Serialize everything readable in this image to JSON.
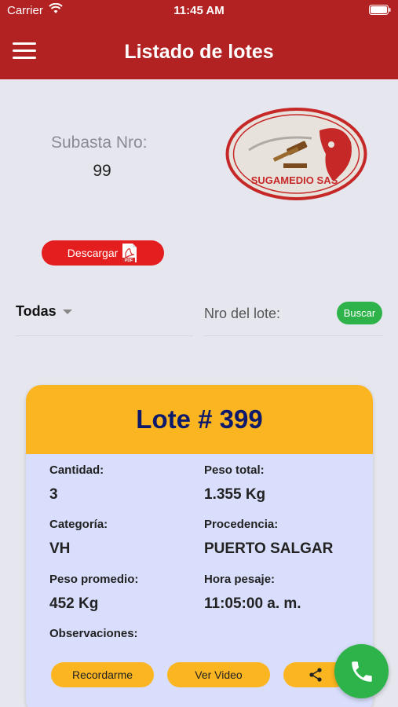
{
  "status_bar": {
    "carrier": "Carrier",
    "time": "11:45 AM"
  },
  "header": {
    "title": "Listado de lotes"
  },
  "subasta": {
    "label": "Subasta Nro:",
    "value": "99"
  },
  "logo": {
    "text": "SUGAMEDIO SAS"
  },
  "download": {
    "label": "Descargar",
    "icon_text": "PDF"
  },
  "filter": {
    "selected": "Todas",
    "lote_placeholder": "Nro del lote:",
    "search_label": "Buscar"
  },
  "lot": {
    "title": "Lote # 399",
    "cantidad_label": "Cantidad:",
    "cantidad": "3",
    "peso_total_label": "Peso total:",
    "peso_total": "1.355 Kg",
    "categoria_label": "Categoría:",
    "categoria": "VH",
    "procedencia_label": "Procedencia:",
    "procedencia": "PUERTO SALGAR",
    "peso_promedio_label": "Peso promedio:",
    "peso_promedio": "452 Kg",
    "hora_pesaje_label": "Hora pesaje:",
    "hora_pesaje": "11:05:00 a. m.",
    "observaciones_label": "Observaciones:",
    "remind_label": "Recordarme",
    "video_label": "Ver Video"
  },
  "colors": {
    "header": "#b22222",
    "accent": "#fbb520",
    "card_bg": "#d8defb",
    "green": "#2db34a",
    "title_navy": "#0d1a6b"
  },
  "icons": [
    "menu-icon",
    "wifi-icon",
    "battery-icon",
    "pdf-icon",
    "chevron-down-icon",
    "share-icon",
    "phone-icon"
  ]
}
